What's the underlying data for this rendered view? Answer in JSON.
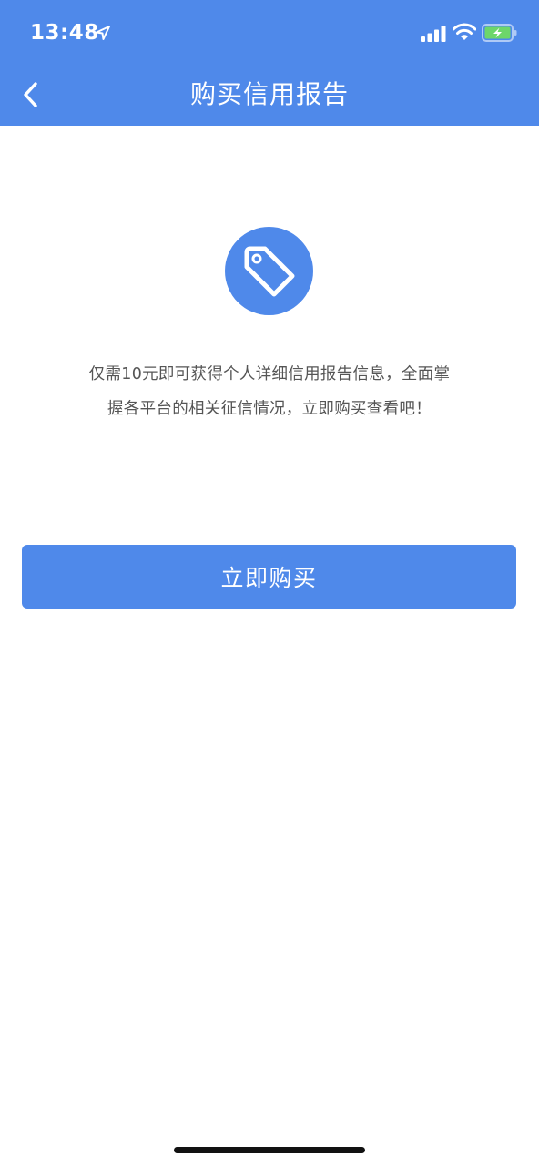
{
  "status_bar": {
    "time": "13:48",
    "icons": [
      "location-arrow-icon",
      "cellular-signal-icon",
      "wifi-icon",
      "battery-charging-icon"
    ]
  },
  "nav": {
    "back_icon": "chevron-left-icon",
    "title": "购买信用报告"
  },
  "main": {
    "badge_icon": "price-tag-icon",
    "description_line1": "仅需10元即可获得个人详细信用报告信息，全面掌",
    "description_line2": "握各平台的相关征信情况，立即购买查看吧！",
    "buy_button_label": "立即购买"
  },
  "colors": {
    "primary": "#4f89ea",
    "text_secondary": "#555555",
    "background": "#ffffff",
    "battery_fill": "#6dd66a"
  }
}
